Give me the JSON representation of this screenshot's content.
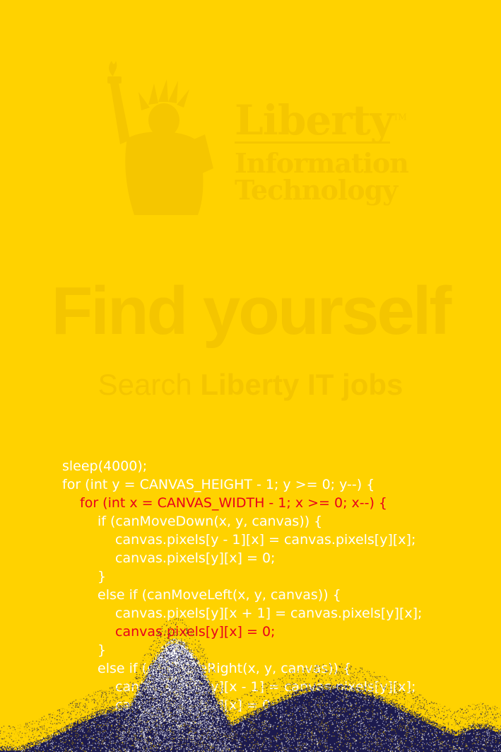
{
  "colors": {
    "background": "#FFD200",
    "code_text": "#FFFFFF",
    "code_highlight": "#E8001C",
    "sand_dark": "#1C1A4E",
    "sand_light": "#FFFFFF"
  },
  "logo": {
    "icon": "statue-of-liberty-icon",
    "word": "Liberty",
    "tm": "TM",
    "line1": "Information",
    "line2": "Technology"
  },
  "headline": "Find yourself",
  "subline": {
    "plain": "Search ",
    "bold": "Liberty IT jobs"
  },
  "code": [
    {
      "text": "sleep(4000);",
      "indent": 0,
      "highlight": false
    },
    {
      "text": "for (int y = CANVAS_HEIGHT - 1; y >= 0; y--) {",
      "indent": 0,
      "highlight": false
    },
    {
      "text": "for (int x = CANVAS_WIDTH - 1; x >= 0; x--) {",
      "indent": 1,
      "highlight": true
    },
    {
      "text": "if (canMoveDown(x, y, canvas)) {",
      "indent": 2,
      "highlight": false
    },
    {
      "text": "canvas.pixels[y - 1][x] = canvas.pixels[y][x];",
      "indent": 3,
      "highlight": false
    },
    {
      "text": "canvas.pixels[y][x] = 0;",
      "indent": 3,
      "highlight": false
    },
    {
      "text": "}",
      "indent": 2,
      "highlight": false
    },
    {
      "text": "else if (canMoveLeft(x, y, canvas)) {",
      "indent": 2,
      "highlight": false
    },
    {
      "text": "canvas.pixels[y][x + 1] = canvas.pixels[y][x];",
      "indent": 3,
      "highlight": false
    },
    {
      "text": "canvas.pixels[y][x] = 0;",
      "indent": 3,
      "highlight": true
    },
    {
      "text": "}",
      "indent": 2,
      "highlight": false
    },
    {
      "text": "else if (canMoveRight(x, y, canvas)) {",
      "indent": 2,
      "highlight": false
    },
    {
      "text": "canvas.pixels[y][x - 1] = canvas.pixels[y][x];",
      "indent": 3,
      "highlight": false
    },
    {
      "text": "canvas.pixels[y][x] = 0;",
      "indent": 3,
      "highlight": false
    },
    {
      "text": "}",
      "indent": 2,
      "highlight": false
    }
  ]
}
